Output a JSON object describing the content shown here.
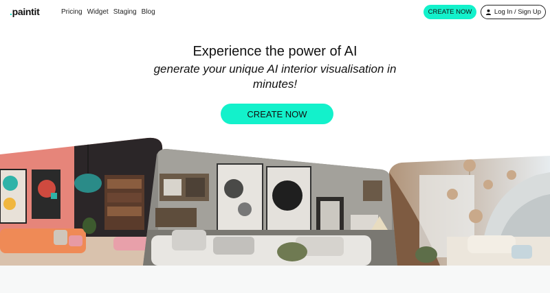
{
  "nav": {
    "logo": "paintit",
    "links": [
      "Pricing",
      "Widget",
      "Staging",
      "Blog"
    ],
    "create_label": "CREATE NOW",
    "login_label": "Log In / Sign Up",
    "icons": {
      "user": "user-icon"
    }
  },
  "hero": {
    "title": "Experience the power of AI",
    "subtitle": "generate your unique AI interior visualisation in minutes!",
    "cta_label": "CREATE NOW"
  },
  "colors": {
    "accent": "#13f1cb",
    "text": "#111111",
    "background": "#ffffff"
  },
  "gallery": {
    "images": [
      "coral-living-room-image",
      "gray-gallery-wall-living-room-image",
      "organic-arch-interior-image"
    ]
  }
}
